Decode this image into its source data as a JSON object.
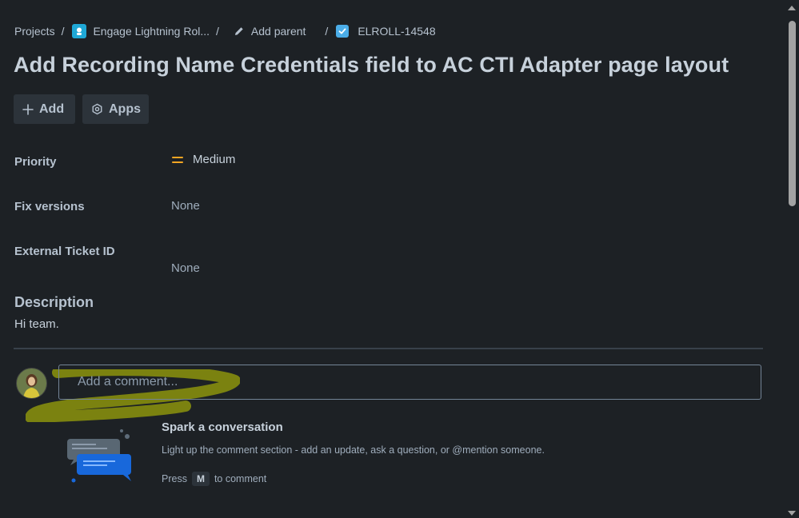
{
  "breadcrumb": {
    "projects": "Projects",
    "project_name": "Engage Lightning Rol...",
    "add_parent": "Add parent",
    "issue_key": "ELROLL-14548",
    "separator": "/"
  },
  "issue": {
    "title": "Add Recording Name Credentials field to AC CTI Adapter page layout"
  },
  "actions": {
    "add_label": "Add",
    "apps_label": "Apps"
  },
  "fields": {
    "priority_label": "Priority",
    "priority_value": "Medium",
    "fix_versions_label": "Fix versions",
    "fix_versions_value": "None",
    "external_ticket_label": "External Ticket ID",
    "external_ticket_value": "None"
  },
  "description": {
    "heading": "Description",
    "text": "Hi team."
  },
  "comment": {
    "placeholder": "Add a comment..."
  },
  "empty_state": {
    "title": "Spark a conversation",
    "subtitle": "Light up the comment section - add an update, ask a question, or @mention someone.",
    "press_prefix": "Press",
    "shortcut_key": "M",
    "press_suffix": "to comment"
  },
  "colors": {
    "background": "#1d2125",
    "priority_medium": "#f5a623",
    "highlight_annotation": "#c8d400"
  },
  "icons": {
    "project": "project-avatar-icon",
    "add_parent": "pencil-icon",
    "issue_type": "task-checkbox-icon",
    "add": "plus-icon",
    "apps": "apps-hexagon-icon",
    "priority": "priority-medium-icon"
  }
}
